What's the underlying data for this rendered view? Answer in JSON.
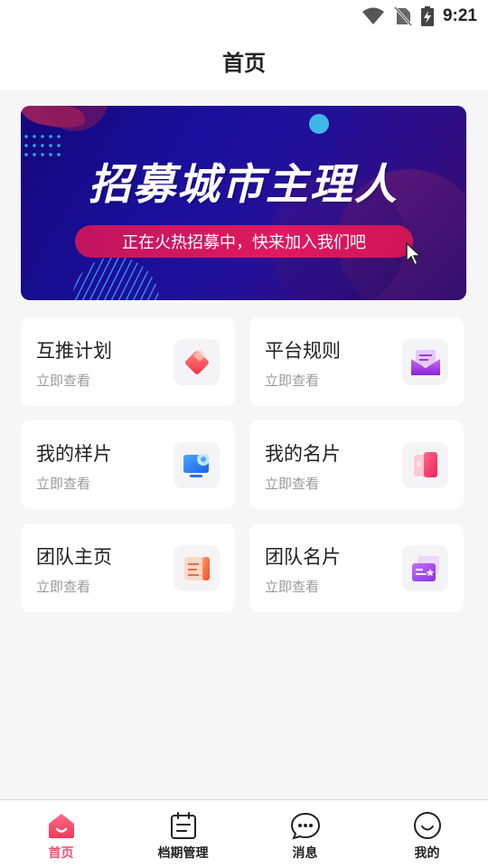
{
  "status_bar": {
    "time": "9:21"
  },
  "header": {
    "title": "首页"
  },
  "banner": {
    "headline": "招募城市主理人",
    "subline": "正在火热招募中，快来加入我们吧"
  },
  "cards": [
    {
      "title": "互推计划",
      "subtitle": "立即查看",
      "icon": "red-diamond-icon"
    },
    {
      "title": "平台规则",
      "subtitle": "立即查看",
      "icon": "purple-envelope-icon"
    },
    {
      "title": "我的样片",
      "subtitle": "立即查看",
      "icon": "blue-monitor-icon"
    },
    {
      "title": "我的名片",
      "subtitle": "立即查看",
      "icon": "pink-card-icon"
    },
    {
      "title": "团队主页",
      "subtitle": "立即查看",
      "icon": "orange-document-icon"
    },
    {
      "title": "团队名片",
      "subtitle": "立即查看",
      "icon": "purple-id-card-icon"
    }
  ],
  "tabs": [
    {
      "label": "首页",
      "icon": "home-icon",
      "active": true
    },
    {
      "label": "档期管理",
      "icon": "calendar-icon",
      "active": false
    },
    {
      "label": "消息",
      "icon": "chat-bubble-icon",
      "active": false
    },
    {
      "label": "我的",
      "icon": "smile-face-icon",
      "active": false
    }
  ],
  "colors": {
    "accent": "#f0506e",
    "banner_bg": "#1a0f9c",
    "banner_pill": "#e0185f"
  }
}
